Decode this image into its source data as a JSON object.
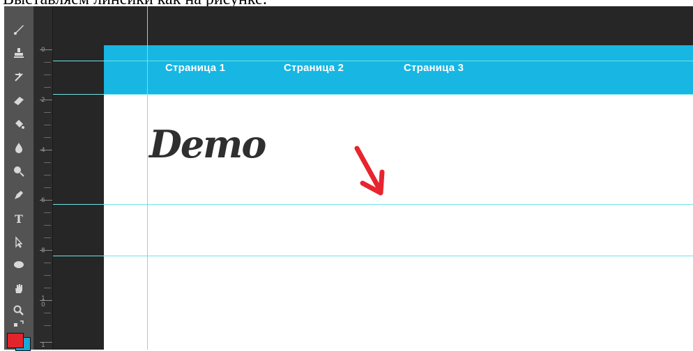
{
  "caption": {
    "text": "Выставляем линейки как на рисунке:"
  },
  "nav": {
    "items": [
      "Страница 1",
      "Страница 2",
      "Страница 3"
    ]
  },
  "logo": {
    "text": "Demo"
  },
  "ruler": {
    "labels": [
      "0",
      "2",
      "4",
      "6",
      "8",
      "1\n0",
      "1"
    ]
  },
  "colors": {
    "navbar": "#17b6e3",
    "guides": "#6fe3e8",
    "foreground": "#e4242b",
    "background": "#1aa8d8",
    "arrow": "#e8242e"
  },
  "tools": [
    "brush-icon",
    "stamp-icon",
    "history-brush-icon",
    "eraser-icon",
    "paint-bucket-icon",
    "blur-icon",
    "dodge-icon",
    "pen-icon",
    "type-icon",
    "path-select-icon",
    "shape-icon",
    "hand-icon",
    "zoom-icon",
    "swap-colors-icon"
  ]
}
